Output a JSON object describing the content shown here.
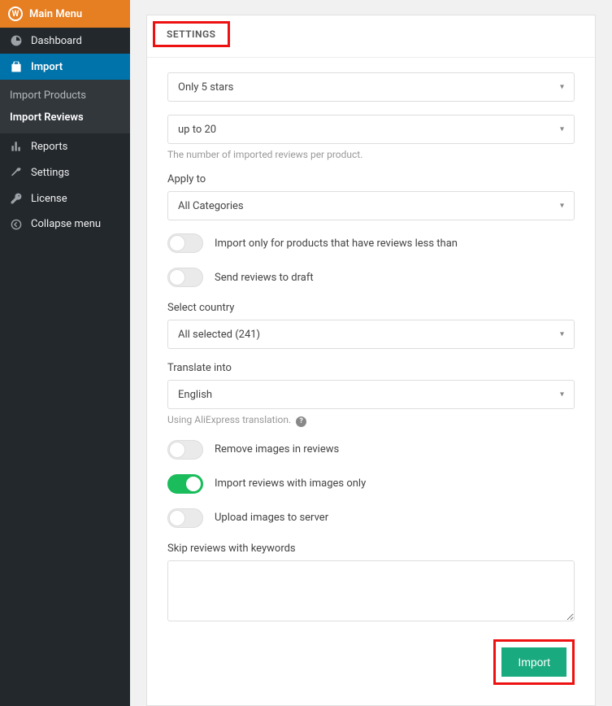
{
  "top": {
    "main_menu": "Main Menu"
  },
  "sidebar": {
    "items": [
      {
        "label": "Dashboard"
      },
      {
        "label": "Import"
      },
      {
        "label": "Reports"
      },
      {
        "label": "Settings"
      },
      {
        "label": "License"
      },
      {
        "label": "Collapse menu"
      }
    ],
    "submenu": [
      {
        "label": "Import Products"
      },
      {
        "label": "Import Reviews"
      }
    ]
  },
  "panel": {
    "title": "SETTINGS",
    "stars": {
      "value": "Only 5 stars"
    },
    "count": {
      "value": "up to 20",
      "help": "The number of imported reviews per product."
    },
    "apply_to": {
      "label": "Apply to",
      "value": "All Categories"
    },
    "toggles": {
      "less_than": "Import only for products that have reviews less than",
      "draft": "Send reviews to draft",
      "remove_images": "Remove images in reviews",
      "images_only": "Import reviews with images only",
      "upload_server": "Upload images to server"
    },
    "country": {
      "label": "Select country",
      "value": "All selected (241)"
    },
    "translate": {
      "label": "Translate into",
      "value": "English",
      "help": "Using AliExpress translation."
    },
    "skip": {
      "label": "Skip reviews with keywords"
    },
    "import_btn": "Import"
  }
}
